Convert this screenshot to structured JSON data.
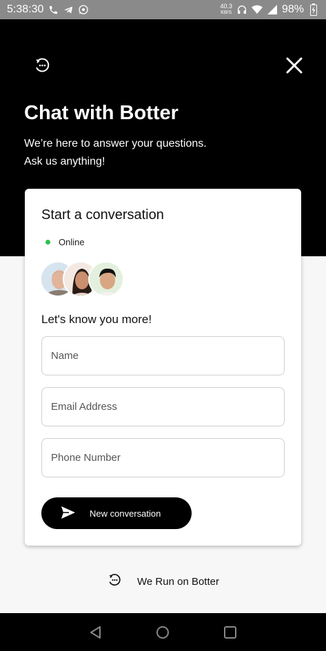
{
  "status_bar": {
    "time": "5:38:30",
    "net_speed_value": "40.3",
    "net_speed_unit": "KB/S",
    "battery": "98%"
  },
  "header": {
    "title": "Chat with Botter",
    "subtitle_line1": "We’re here to answer your questions.",
    "subtitle_line2": "Ask us anything!"
  },
  "card": {
    "title": "Start a conversation",
    "status": "Online",
    "prompt": "Let's know you more!",
    "fields": {
      "name_placeholder": "Name",
      "email_placeholder": "Email Address",
      "phone_placeholder": "Phone Number"
    },
    "cta_label": "New conversation"
  },
  "footer": {
    "text": "We Run on Botter"
  },
  "colors": {
    "header_bg": "#000000",
    "accent": "#000000",
    "online": "#2fbf4a",
    "page_bg": "#f7f7f7"
  },
  "icons": [
    "botter-logo-icon",
    "close-icon",
    "send-icon",
    "back-icon",
    "home-icon",
    "recents-icon"
  ]
}
